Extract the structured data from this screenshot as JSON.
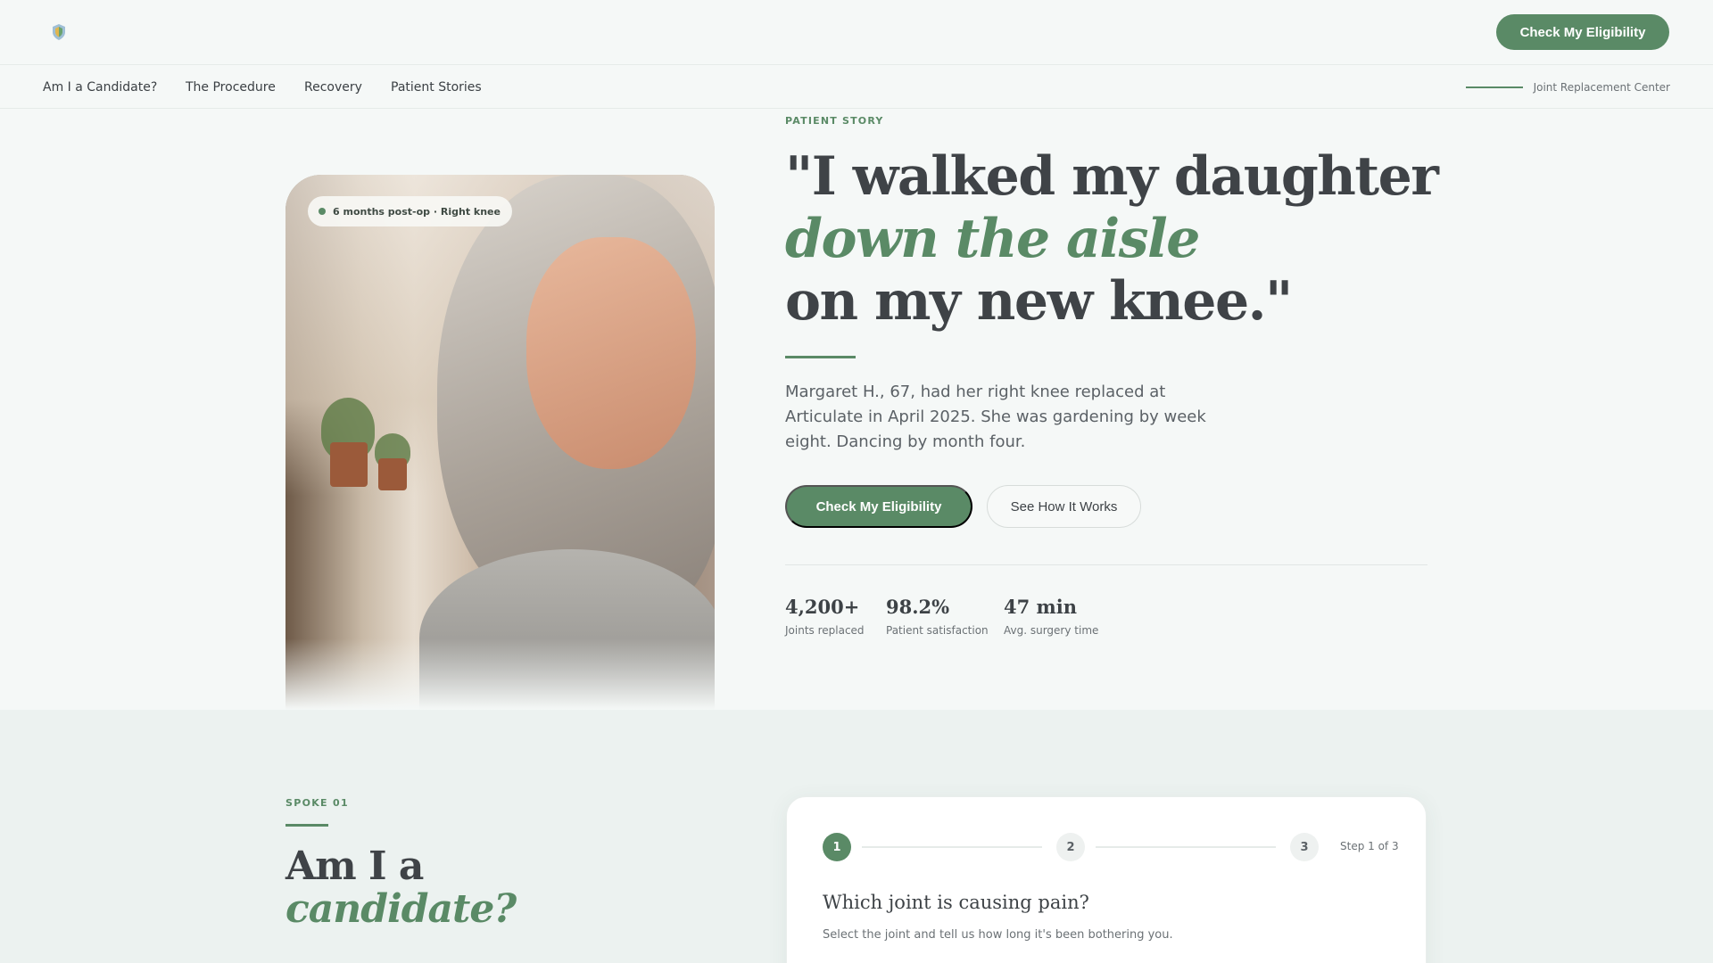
{
  "header": {
    "cta_label": "Check My Eligibility",
    "logo_icon": "shield-leaf-icon"
  },
  "nav": {
    "items": [
      "Am I a Candidate?",
      "The Procedure",
      "Recovery",
      "Patient Stories"
    ],
    "right_label": "Joint Replacement Center"
  },
  "hero": {
    "photo_badge": "6 months post-op · Right knee",
    "eyebrow": "PATIENT STORY",
    "headline_1": "\"I walked my daughter",
    "headline_2": "down the aisle",
    "headline_3": "on my new knee.\"",
    "lead": "Margaret H., 67, had her right knee replaced at Articulate in April 2025. She was gardening by week eight. Dancing by month four.",
    "primary_cta": "Check My Eligibility",
    "secondary_cta": "See How It Works",
    "stats": [
      {
        "value": "4,200+",
        "label": "Joints replaced"
      },
      {
        "value": "98.2%",
        "label": "Patient satisfaction"
      },
      {
        "value": "47 min",
        "label": "Avg. surgery time"
      }
    ]
  },
  "candidate": {
    "eyebrow": "SPOKE 01",
    "title_1": "Am I a",
    "title_2": "candidate?",
    "steps": [
      "1",
      "2",
      "3"
    ],
    "step_of": "Step 1 of 3",
    "question": "Which joint is causing pain?",
    "question_sub": "Select the joint and tell us how long it's been bothering you."
  },
  "colors": {
    "accent": "#5a8a66",
    "background": "#f5f8f7",
    "section_bg": "#ecf2f0",
    "text": "#3d4246"
  }
}
